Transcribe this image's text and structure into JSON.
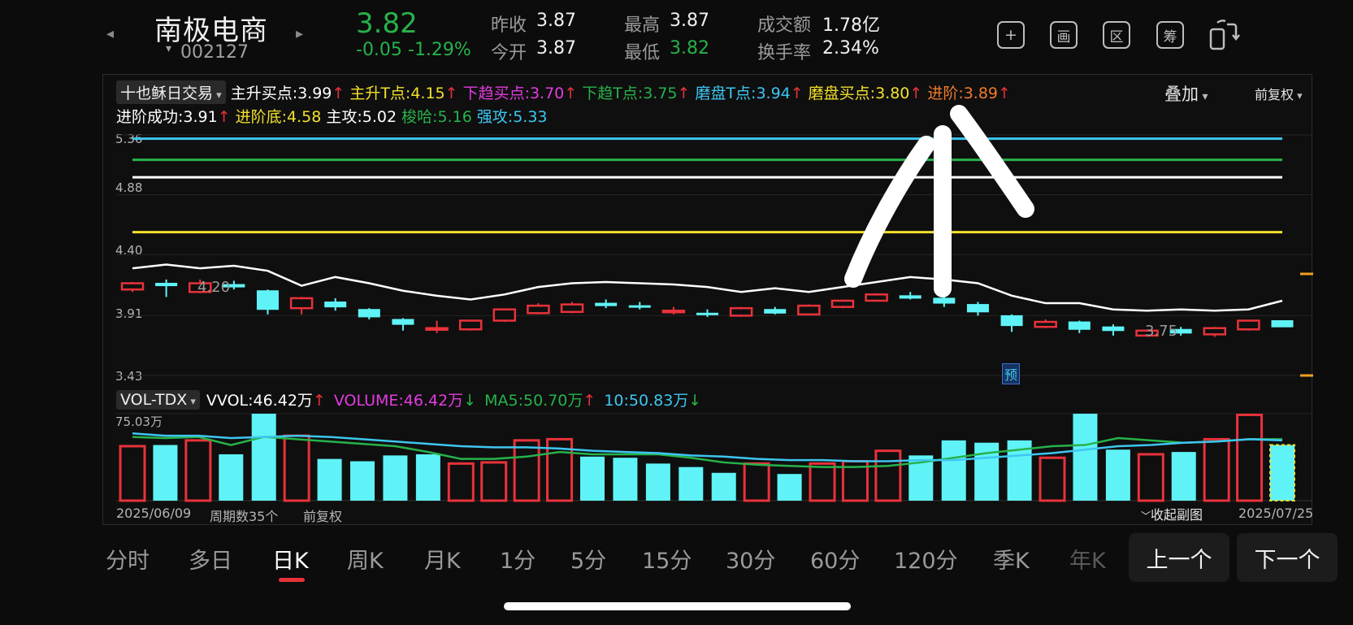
{
  "header": {
    "prev_icon": "chevron-left-icon",
    "next_icon": "chevron-right-icon",
    "name": "南极电商",
    "code": "002127",
    "price": "3.82",
    "change": "-0.05",
    "change_pct": "-1.29%",
    "stats": [
      {
        "label": "昨收",
        "value": "3.87"
      },
      {
        "label": "今开",
        "value": "3.87"
      },
      {
        "label": "最高",
        "value": "3.87"
      },
      {
        "label": "最低",
        "value": "3.82"
      },
      {
        "label": "成交额",
        "value": "1.78亿"
      },
      {
        "label": "换手率",
        "value": "2.34%"
      }
    ],
    "tools": [
      "+",
      "画",
      "区",
      "筹"
    ],
    "tool_icons": [
      "add-icon",
      "draw-icon",
      "range-icon",
      "chips-icon",
      "rotate-screen-icon"
    ]
  },
  "indicator": {
    "selector": "十也稣日交易",
    "items_row1": [
      {
        "label": "主升买点:",
        "value": "3.99",
        "color": "#ffffff",
        "arrow": "↑"
      },
      {
        "label": "主升T点:",
        "value": "4.15",
        "color": "#f2e02b",
        "arrow": "↑"
      },
      {
        "label": "下趋买点:",
        "value": "3.70",
        "color": "#e23ce0",
        "arrow": "↑"
      },
      {
        "label": "下趋T点:",
        "value": "3.75",
        "color": "#27b24a",
        "arrow": "↑"
      },
      {
        "label": "磨盘T点:",
        "value": "3.94",
        "color": "#3ec6f0",
        "arrow": "↑"
      },
      {
        "label": "磨盘买点:",
        "value": "3.80",
        "color": "#f2e02b",
        "arrow": "↑"
      },
      {
        "label": "进阶:",
        "value": "3.89",
        "color": "#f07a2b",
        "arrow": "↑"
      }
    ],
    "items_row2": [
      {
        "label": "进阶成功:",
        "value": "3.91",
        "color": "#ffffff",
        "arrow": "↑"
      },
      {
        "label": "进阶底:",
        "value": "4.58",
        "color": "#f2e02b",
        "arrow": ""
      },
      {
        "label": "主攻:",
        "value": "5.02",
        "color": "#ffffff",
        "arrow": ""
      },
      {
        "label": "梭哈:",
        "value": "5.16",
        "color": "#27b24a",
        "arrow": ""
      },
      {
        "label": "强攻:",
        "value": "5.33",
        "color": "#3ec6f0",
        "arrow": ""
      }
    ],
    "overlay_label": "叠加",
    "adjust_label": "前复权"
  },
  "chart_data": {
    "type": "candlestick",
    "price_axis": {
      "labels": [
        "5.36",
        "4.88",
        "4.40",
        "3.91",
        "3.43"
      ],
      "ylim": [
        3.43,
        5.36
      ]
    },
    "hlines": [
      {
        "value": 5.33,
        "color": "#3ec6f0"
      },
      {
        "value": 5.16,
        "color": "#27b24a"
      },
      {
        "value": 5.02,
        "color": "#ffffff"
      },
      {
        "value": 4.58,
        "color": "#f2e02b"
      }
    ],
    "candles": [
      {
        "o": 4.12,
        "c": 4.17,
        "h": 4.18,
        "l": 4.1
      },
      {
        "o": 4.17,
        "c": 4.15,
        "h": 4.2,
        "l": 4.06
      },
      {
        "o": 4.1,
        "c": 4.17,
        "h": 4.2,
        "l": 4.09
      },
      {
        "o": 4.16,
        "c": 4.14,
        "h": 4.19,
        "l": 4.12
      },
      {
        "o": 4.11,
        "c": 3.96,
        "h": 4.12,
        "l": 3.92
      },
      {
        "o": 3.97,
        "c": 4.05,
        "h": 4.06,
        "l": 3.92
      },
      {
        "o": 4.02,
        "c": 3.98,
        "h": 4.05,
        "l": 3.95
      },
      {
        "o": 3.96,
        "c": 3.9,
        "h": 3.97,
        "l": 3.88
      },
      {
        "o": 3.88,
        "c": 3.84,
        "h": 3.89,
        "l": 3.79
      },
      {
        "o": 3.81,
        "c": 3.81,
        "h": 3.87,
        "l": 3.77
      },
      {
        "o": 3.8,
        "c": 3.87,
        "h": 3.87,
        "l": 3.79
      },
      {
        "o": 3.87,
        "c": 3.96,
        "h": 3.96,
        "l": 3.86
      },
      {
        "o": 3.93,
        "c": 3.99,
        "h": 4.01,
        "l": 3.92
      },
      {
        "o": 3.94,
        "c": 4.0,
        "h": 4.02,
        "l": 3.93
      },
      {
        "o": 4.01,
        "c": 3.99,
        "h": 4.04,
        "l": 3.97
      },
      {
        "o": 3.99,
        "c": 3.98,
        "h": 4.02,
        "l": 3.96
      },
      {
        "o": 3.95,
        "c": 3.95,
        "h": 3.98,
        "l": 3.92
      },
      {
        "o": 3.93,
        "c": 3.92,
        "h": 3.96,
        "l": 3.9
      },
      {
        "o": 3.91,
        "c": 3.97,
        "h": 3.98,
        "l": 3.9
      },
      {
        "o": 3.96,
        "c": 3.93,
        "h": 3.98,
        "l": 3.92
      },
      {
        "o": 3.92,
        "c": 3.99,
        "h": 4.0,
        "l": 3.92
      },
      {
        "o": 3.98,
        "c": 4.03,
        "h": 4.03,
        "l": 3.97
      },
      {
        "o": 4.03,
        "c": 4.08,
        "h": 4.09,
        "l": 4.03
      },
      {
        "o": 4.07,
        "c": 4.05,
        "h": 4.1,
        "l": 4.04
      },
      {
        "o": 4.05,
        "c": 4.01,
        "h": 4.07,
        "l": 3.98
      },
      {
        "o": 4.0,
        "c": 3.94,
        "h": 4.02,
        "l": 3.91
      },
      {
        "o": 3.91,
        "c": 3.83,
        "h": 3.92,
        "l": 3.78
      },
      {
        "o": 3.82,
        "c": 3.86,
        "h": 3.88,
        "l": 3.81
      },
      {
        "o": 3.86,
        "c": 3.8,
        "h": 3.87,
        "l": 3.77
      },
      {
        "o": 3.82,
        "c": 3.79,
        "h": 3.84,
        "l": 3.75
      },
      {
        "o": 3.75,
        "c": 3.79,
        "h": 3.8,
        "l": 3.74
      },
      {
        "o": 3.8,
        "c": 3.77,
        "h": 3.82,
        "l": 3.75
      },
      {
        "o": 3.76,
        "c": 3.81,
        "h": 3.82,
        "l": 3.74
      },
      {
        "o": 3.8,
        "c": 3.87,
        "h": 3.87,
        "l": 3.79
      },
      {
        "o": 3.87,
        "c": 3.82,
        "h": 3.87,
        "l": 3.82
      }
    ],
    "line_white": [
      4.29,
      4.32,
      4.29,
      4.31,
      4.27,
      4.15,
      4.22,
      4.17,
      4.11,
      4.07,
      4.04,
      4.08,
      4.14,
      4.17,
      4.18,
      4.17,
      4.16,
      4.14,
      4.1,
      4.13,
      4.1,
      4.14,
      4.18,
      4.22,
      4.2,
      4.17,
      4.07,
      4.01,
      4.01,
      3.96,
      3.95,
      3.96,
      3.95,
      3.96,
      4.03
    ],
    "price_annotations": [
      "4.20",
      "3.75"
    ],
    "predict_label": "预",
    "volume": {
      "axis_top": "75.03万",
      "values": [
        47,
        48,
        52,
        40,
        75,
        56,
        36,
        34,
        39,
        40,
        32,
        33,
        52,
        53,
        38,
        37,
        32,
        29,
        24,
        32,
        23,
        32,
        34,
        43,
        39,
        52,
        50,
        52,
        37,
        75,
        44,
        40,
        42,
        53,
        74,
        48
      ],
      "up": [
        true,
        false,
        true,
        false,
        false,
        true,
        false,
        false,
        false,
        false,
        true,
        true,
        true,
        true,
        false,
        false,
        false,
        false,
        false,
        true,
        false,
        true,
        true,
        true,
        false,
        false,
        false,
        false,
        true,
        false,
        false,
        true,
        false,
        true,
        true,
        false
      ],
      "ma5": [
        55,
        54,
        55,
        48,
        55,
        53,
        51,
        49,
        47,
        42,
        36,
        36,
        38,
        42,
        40,
        40,
        40,
        37,
        33,
        31,
        30,
        29,
        29,
        30,
        33,
        37,
        41,
        44,
        47,
        48,
        54,
        52,
        50,
        51,
        53,
        53
      ],
      "ma10": [
        58,
        56,
        56,
        54,
        55,
        56,
        55,
        53,
        51,
        49,
        47,
        46,
        46,
        45,
        43,
        42,
        41,
        39,
        38,
        36,
        35,
        35,
        34,
        34,
        35,
        35,
        37,
        39,
        41,
        44,
        47,
        48,
        50,
        51,
        53,
        52
      ]
    }
  },
  "volume_legend": {
    "selector": "VOL-TDX",
    "items": [
      {
        "text": "VVOL:46.42万",
        "color": "#ffffff",
        "arrow": "↑",
        "arrow_color": "#e8323a"
      },
      {
        "text": "VOLUME:46.42万",
        "color": "#e23ce0",
        "arrow": "↓",
        "arrow_color": "#27b24a"
      },
      {
        "text": "MA5:50.70万",
        "color": "#27b24a",
        "arrow": "↑",
        "arrow_color": "#e8323a"
      },
      {
        "text": "10:50.83万",
        "color": "#3ec6f0",
        "arrow": "↓",
        "arrow_color": "#27b24a"
      }
    ]
  },
  "footer_row": {
    "start_date": "2025/06/09",
    "period_count": "周期数35个",
    "adjust": "前复权",
    "collapse": "收起副图",
    "end_date": "2025/07/25"
  },
  "tabs": [
    "分时",
    "多日",
    "日K",
    "周K",
    "月K",
    "1分",
    "5分",
    "15分",
    "30分",
    "60分",
    "120分",
    "季K",
    "年K"
  ],
  "active_tab": "日K",
  "nav": {
    "prev": "上一个",
    "next": "下一个"
  },
  "colors": {
    "up": "#e8323a",
    "down_fill": "#5ff3f7",
    "ma_white": "#ffffff",
    "ma5": "#27b24a",
    "ma10": "#3ec6f0"
  }
}
